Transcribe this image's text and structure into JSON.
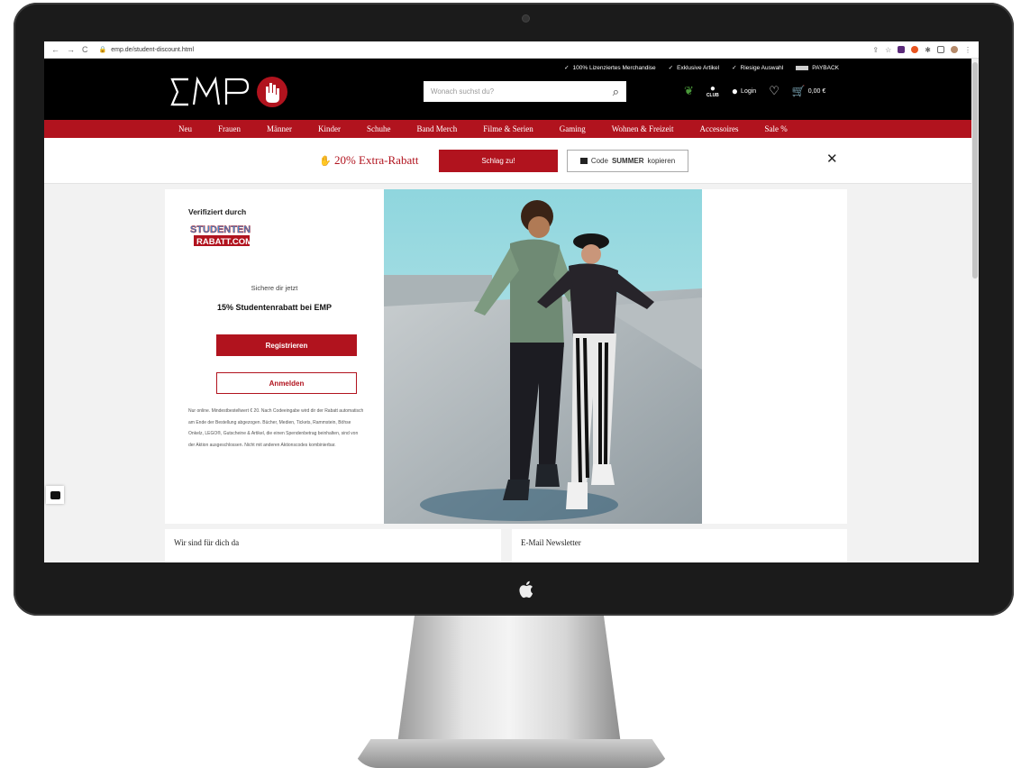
{
  "browser": {
    "url": "emp.de/student-discount.html"
  },
  "header": {
    "usps": [
      "100% Lizenziertes Merchandise",
      "Exklusive Artikel",
      "Riesige Auswahl"
    ],
    "payback": "PAYBACK",
    "search_placeholder": "Wonach suchst du?",
    "club_label": "CLUB",
    "login_label": "Login",
    "cart_total": "0,00 €"
  },
  "nav": {
    "items": [
      "Neu",
      "Frauen",
      "Männer",
      "Kinder",
      "Schuhe",
      "Band Merch",
      "Filme & Serien",
      "Gaming",
      "Wohnen & Freizeit",
      "Accessoires",
      "Sale %"
    ]
  },
  "promo": {
    "text": "20% Extra-Rabatt",
    "cta_label": "Schlag zu!",
    "code_prefix": "Code",
    "code": "SUMMER",
    "code_suffix": "kopieren"
  },
  "student": {
    "verified_label": "Verifiziert durch",
    "partner_logo_text_1": "STUDENTEN",
    "partner_logo_text_2": "RABATT.COM",
    "intro": "Sichere dir jetzt",
    "headline": "15% Studentenrabatt bei EMP",
    "register_label": "Registrieren",
    "login_label": "Anmelden",
    "fineprint": "Nur online. Mindestbestellwert € 20. Nach Codeeingabe wird dir der Rabatt automatisch am Ende der Bestellung abgezogen. Bücher, Medien, Tickets, Rammstein, Böhse Onkelz, LEGO®, Gutscheine & Artikel, die einen Spendenbetrag beinhalten, sind von der Aktion ausgeschlossen. Nicht mit anderen Aktionscodes kombinierbar."
  },
  "footer_sections": {
    "support_title": "Wir sind für dich da",
    "newsletter_title": "E-Mail Newsletter"
  },
  "colors": {
    "brand_red": "#b1131e",
    "header_black": "#000000"
  }
}
